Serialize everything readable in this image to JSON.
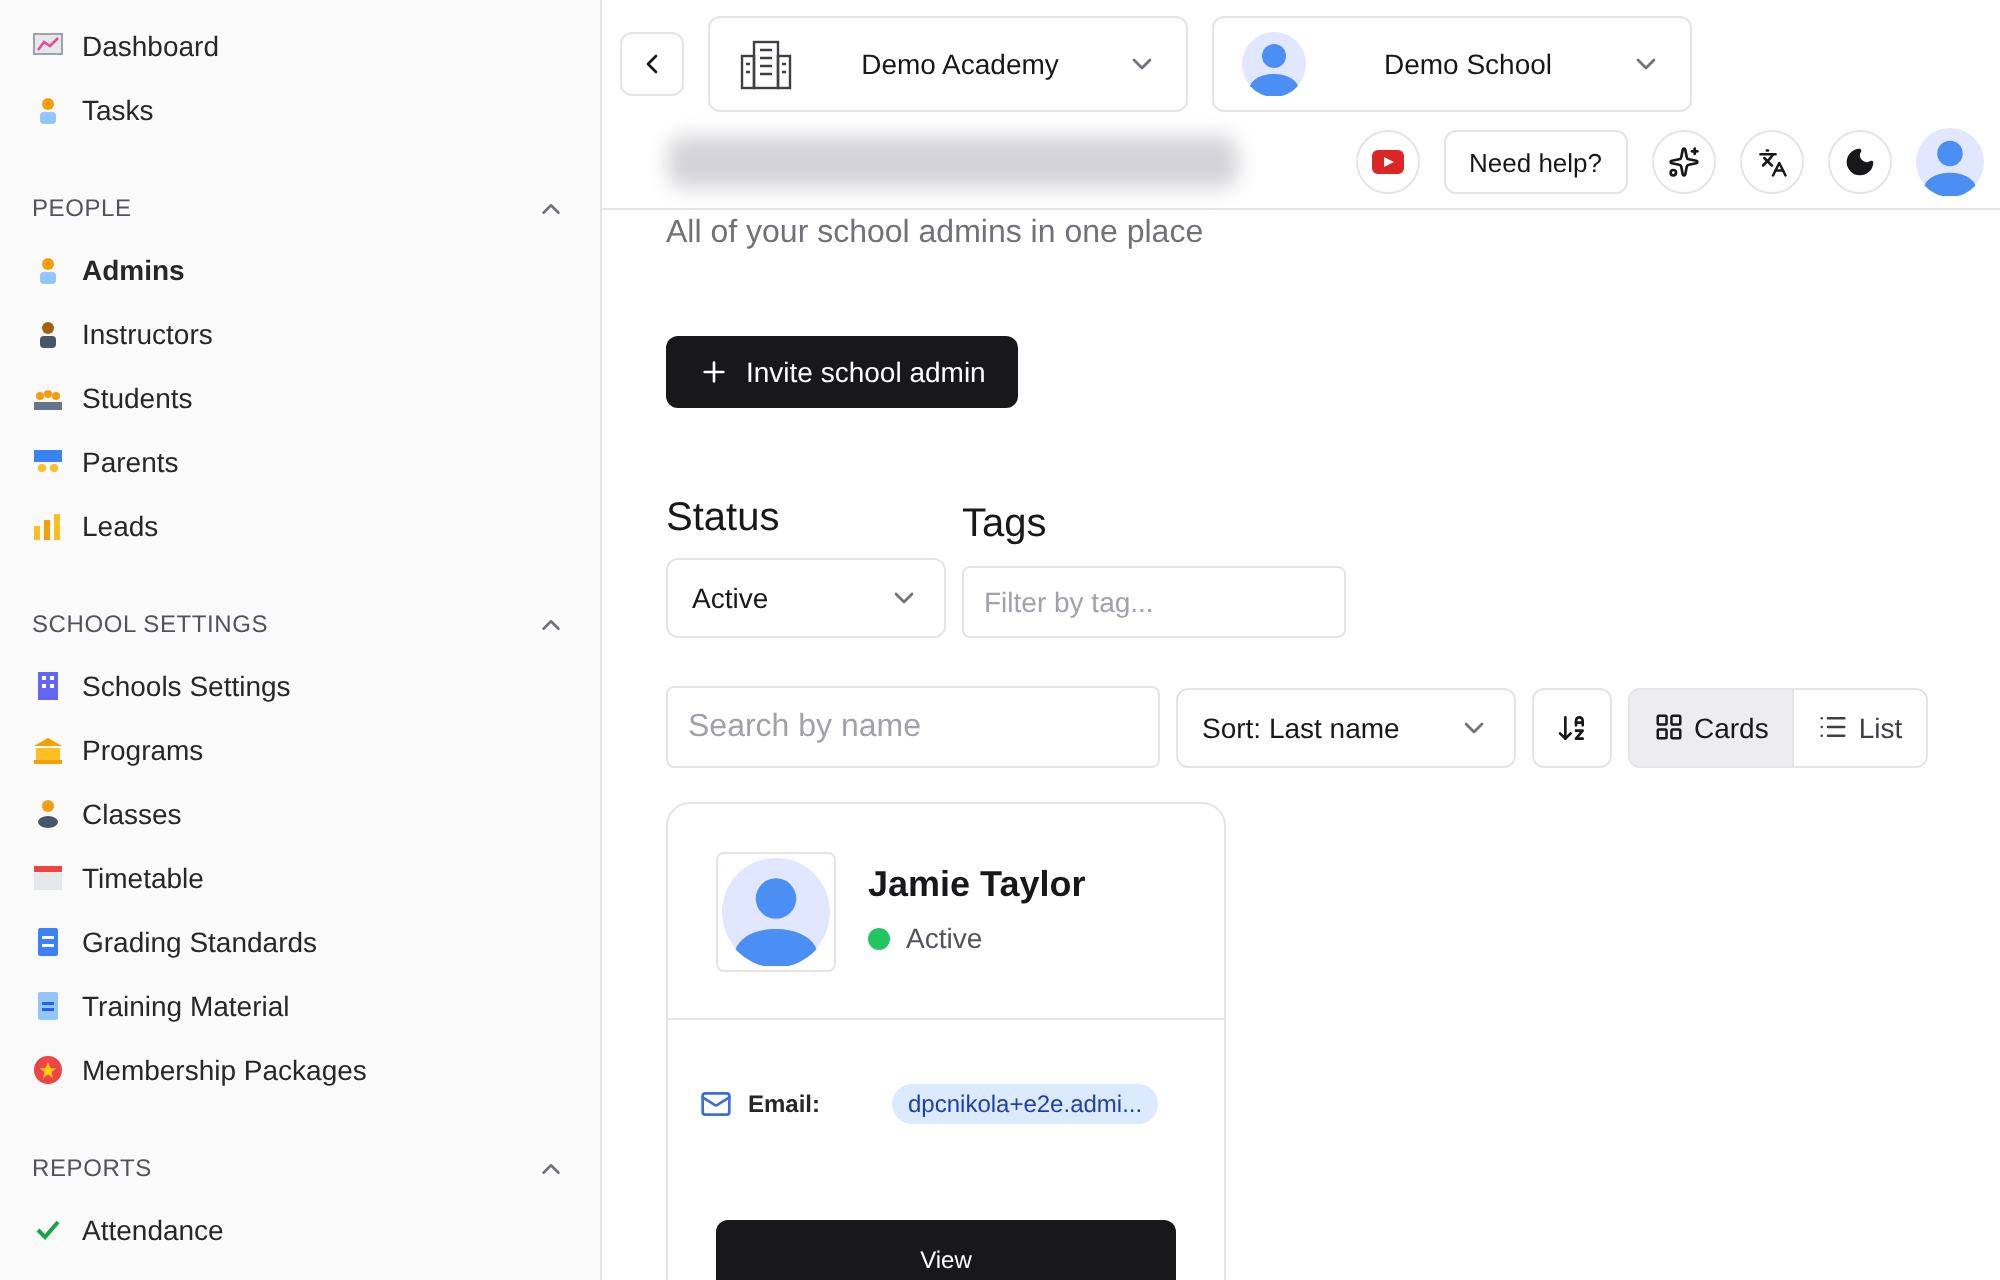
{
  "sidebar": {
    "top_items": [
      {
        "label": "Dashboard",
        "selected": false
      },
      {
        "label": "Tasks",
        "selected": false
      }
    ],
    "sections": [
      {
        "title": "PEOPLE",
        "expanded": true,
        "items": [
          {
            "label": "Admins",
            "selected": true
          },
          {
            "label": "Instructors",
            "selected": false
          },
          {
            "label": "Students",
            "selected": false
          },
          {
            "label": "Parents",
            "selected": false
          },
          {
            "label": "Leads",
            "selected": false
          }
        ]
      },
      {
        "title": "SCHOOL SETTINGS",
        "expanded": true,
        "items": [
          {
            "label": "Schools Settings",
            "selected": false
          },
          {
            "label": "Programs",
            "selected": false
          },
          {
            "label": "Classes",
            "selected": false
          },
          {
            "label": "Timetable",
            "selected": false
          },
          {
            "label": "Grading Standards",
            "selected": false
          },
          {
            "label": "Training Material",
            "selected": false
          },
          {
            "label": "Membership Packages",
            "selected": false
          }
        ]
      },
      {
        "title": "REPORTS",
        "expanded": true,
        "items": [
          {
            "label": "Attendance",
            "selected": false
          }
        ]
      }
    ]
  },
  "header": {
    "academy_select": "Demo Academy",
    "school_select": "Demo School",
    "help_button": "Need help?"
  },
  "page": {
    "subtitle": "All of your school admins in one place",
    "invite_button": "Invite school admin",
    "filters": {
      "status_label": "Status",
      "status_value": "Active",
      "tags_label": "Tags",
      "tags_placeholder": "Filter by tag..."
    },
    "search_placeholder": "Search by name",
    "sort": "Sort: Last name",
    "views": [
      {
        "label": "Cards",
        "selected": true
      },
      {
        "label": "List",
        "selected": false
      }
    ]
  },
  "admins": [
    {
      "name": "Jamie Taylor",
      "status": "Active",
      "color": "#22c55e",
      "email_label": "Email:",
      "email": "dpcnikola+e2e.admi...",
      "button": "View"
    }
  ]
}
